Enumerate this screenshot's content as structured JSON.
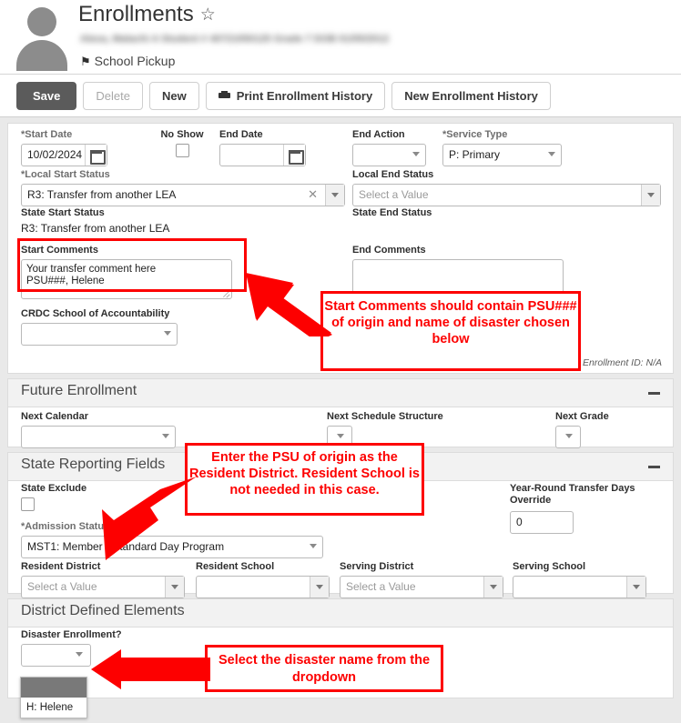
{
  "header": {
    "page_title": "Enrollments",
    "favorite_icon": "star-icon",
    "student_info_redacted": "Alexa, Malachi A    Student # 40721050125  Grade 7  DOB 01/05/2012",
    "flag_label": "School Pickup"
  },
  "toolbar": {
    "save": "Save",
    "delete": "Delete",
    "new": "New",
    "print_enrollment_history": "Print Enrollment History",
    "new_enrollment_history": "New Enrollment History"
  },
  "general": {
    "start_date_label": "*Start Date",
    "start_date_value": "10/02/2024",
    "no_show_label": "No Show",
    "no_show_checked": false,
    "end_date_label": "End Date",
    "end_date_value": "",
    "end_action_label": "End Action",
    "end_action_value": "",
    "service_type_label": "*Service Type",
    "service_type_value": "P: Primary",
    "local_start_status_label": "*Local Start Status",
    "local_start_status_value": "R3: Transfer from another LEA",
    "local_end_status_label": "Local End Status",
    "local_end_status_placeholder": "Select a Value",
    "state_start_status_label": "State Start Status",
    "state_start_status_value": "R3: Transfer from another LEA",
    "state_end_status_label": "State End Status",
    "state_end_status_value": "",
    "start_comments_label": "Start Comments",
    "start_comments_value": "Your transfer comment here\nPSU###, Helene",
    "end_comments_label": "End Comments",
    "end_comments_value": "",
    "crdc_label": "CRDC School of Accountability",
    "crdc_value": "",
    "rolled_from": "Rolled From Enrollment ID: N/A"
  },
  "future_enrollment": {
    "section_title": "Future Enrollment",
    "collapse_icon": "minus-icon",
    "next_calendar_label": "Next Calendar",
    "next_calendar_value": "",
    "next_schedule_structure_label": "Next Schedule Structure",
    "next_schedule_structure_value": "",
    "next_grade_label": "Next Grade",
    "next_grade_value": ""
  },
  "state_reporting": {
    "section_title": "State Reporting Fields",
    "collapse_icon": "minus-icon",
    "state_exclude_label": "State Exclude",
    "state_exclude_checked": false,
    "admission_status_label": "*Admission Status",
    "admission_status_value": "MST1: Member - Standard Day Program",
    "year_round_label": "Year-Round Transfer Days Override",
    "year_round_value": "0",
    "resident_district_label": "Resident District",
    "resident_district_placeholder": "Select a Value",
    "resident_school_label": "Resident School",
    "resident_school_value": "",
    "serving_district_label": "Serving District",
    "serving_district_placeholder": "Select a Value",
    "serving_school_label": "Serving School",
    "serving_school_value": ""
  },
  "district_defined": {
    "section_title": "District Defined Elements",
    "disaster_label": "Disaster Enrollment?",
    "disaster_value": "",
    "dropdown_open": true,
    "dropdown_options": [
      "",
      "H: Helene"
    ]
  },
  "annotations": {
    "callout_1": "Start Comments should contain PSU### of origin and name of disaster chosen below",
    "callout_2": "Enter the PSU of origin as the Resident District. Resident School is not needed in this case.",
    "callout_3": "Select the disaster name from the dropdown",
    "color": "#fd0000",
    "arrow_icon": "arrow-icon"
  }
}
